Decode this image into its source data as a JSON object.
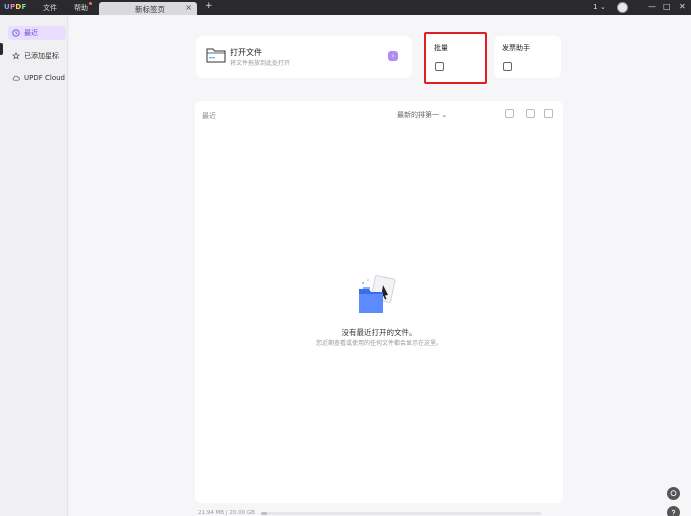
{
  "app": {
    "logo": "UPDF",
    "menus": {
      "file": "文件",
      "help": "帮助"
    }
  },
  "tabs": [
    {
      "label": "新标签页",
      "close": "×"
    }
  ],
  "titlebar": {
    "new_tab": "+",
    "page_num": "1",
    "page_caret": "⌄",
    "window": {
      "min": "—",
      "max": "□",
      "close": "✕"
    }
  },
  "sidebar": {
    "items": [
      {
        "label": "最近",
        "icon": "clock-icon",
        "active": true
      },
      {
        "label": "已添加星标",
        "icon": "star-icon",
        "active": false
      },
      {
        "label": "UPDF Cloud",
        "icon": "cloud-icon",
        "active": false
      }
    ]
  },
  "cards": {
    "open": {
      "title": "打开文件",
      "subtitle": "将文件拖放到此处打开",
      "badge": "›"
    },
    "batch": {
      "title": "批量"
    },
    "assistant": {
      "title": "发票助手"
    }
  },
  "recent": {
    "label": "最近",
    "sort": "最新的排第一  ⌄",
    "empty_title": "没有最近打开的文件。",
    "empty_subtitle": "您近期查看或使用的任何文件都会显示在这里。"
  },
  "storage": {
    "text": "21.94 MB | 20.00 GB",
    "used_fraction": 0.0011
  },
  "colors": {
    "accent": "#6f4bd8",
    "highlight_box": "#e02020",
    "titlebar": "#2a2a2c"
  }
}
